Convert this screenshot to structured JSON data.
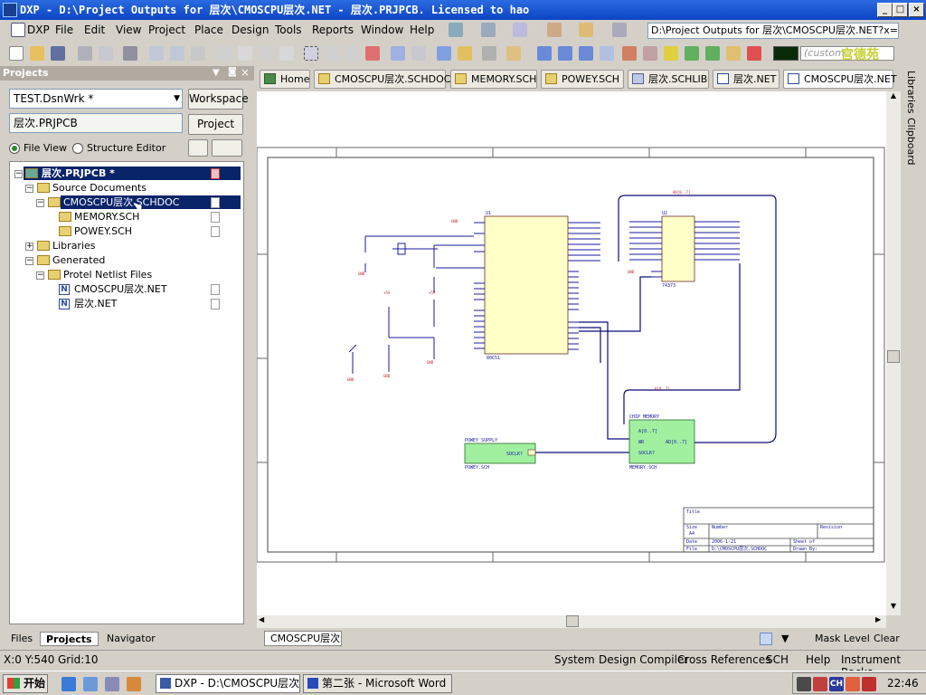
{
  "window": {
    "title": "DXP - D:\\Project Outputs for 层次\\CMOSCPU层次.NET - 层次.PRJPCB. Licensed to hao",
    "minimize": "_",
    "maximize": "□",
    "close": "×"
  },
  "menu": [
    "DXP",
    "File",
    "Edit",
    "View",
    "Project",
    "Place",
    "Design",
    "Tools",
    "Reports",
    "Window",
    "Help"
  ],
  "toolbar": {
    "path_combo": "D:\\Project Outputs for 层次\\CMOSCPU层次.NET?x=2",
    "custom_combo": "(custom",
    "watermark": "宫德苑"
  },
  "projects_panel": {
    "title": "Projects",
    "workspace_combo": "TEST.DsnWrk *",
    "workspace_button": "Workspace",
    "project_field": "层次.PRJPCB",
    "project_button": "Project",
    "radio_file_view": "File View",
    "radio_structure_editor": "Structure Editor",
    "tree": {
      "root": "层次.PRJPCB *",
      "source_documents": "Source Documents",
      "cmoscpu": "CMOSCPU层次.SCHDOC",
      "memory": "MEMORY.SCH",
      "powey": "POWEY.SCH",
      "libraries": "Libraries",
      "generated": "Generated",
      "netlist_files": "Protel Netlist Files",
      "net1": "CMOSCPU层次.NET",
      "net2": "层次.NET"
    },
    "tabs": [
      "Files",
      "Projects",
      "Navigator"
    ]
  },
  "doc_tabs": [
    "Home",
    "CMOSCPU层次.SCHDOC",
    "MEMORY.SCH",
    "POWEY.SCH",
    "层次.SCHLIB",
    "层次.NET",
    "CMOSCPU层次.NET"
  ],
  "sidebar_tabs": [
    "Libraries",
    "Clipboard"
  ],
  "sheet_tab": "CMOSCPU层次",
  "sheet_bottom_tools": {
    "mask_level": "Mask Level",
    "clear": "Clear"
  },
  "status": {
    "coords": "X:0 Y:540",
    "grid": "Grid:10",
    "panels": [
      "System",
      "Design Compiler",
      "Cross References",
      "SCH",
      "Help",
      "Instrument Racks"
    ]
  },
  "taskbar": {
    "start": "开始",
    "tasks": [
      "DXP - D:\\CMOSCPU层次....",
      "第二张 - Microsoft Word"
    ],
    "tray_ch": "CH",
    "clock": "22:46"
  },
  "schematic": {
    "sheet1": {
      "title": "POWEY SUPPLY",
      "port": "SOCLK?",
      "file": "POWEY.SCH"
    },
    "sheet2": {
      "title": "CHIP MEMORY",
      "ports": [
        "A[0..7]",
        "WR",
        "SOCLK?",
        "AD[0..7]"
      ],
      "file": "MEMORY.SCH"
    },
    "bus_labels": [
      "AD[0..7]",
      "A[0..7]"
    ],
    "u1": {
      "ref": "U1",
      "part": "80C51"
    },
    "u2": {
      "ref": "U2",
      "part": "74373"
    },
    "titleblock": {
      "title": "Title",
      "size": "Size",
      "number": "Number",
      "revision": "Revision",
      "size_val": "A4",
      "date_label": "Date",
      "date": "2006-1-21",
      "sheet": "Sheet of",
      "file_label": "File",
      "file": "D:\\CMOSCPU层次.SCHDOC",
      "drawn": "Drawn By:"
    }
  },
  "colors": {
    "sheet_fill": "#a0f0a0",
    "chip_fill": "#ffffc8",
    "wire": "#0a0a7a"
  }
}
